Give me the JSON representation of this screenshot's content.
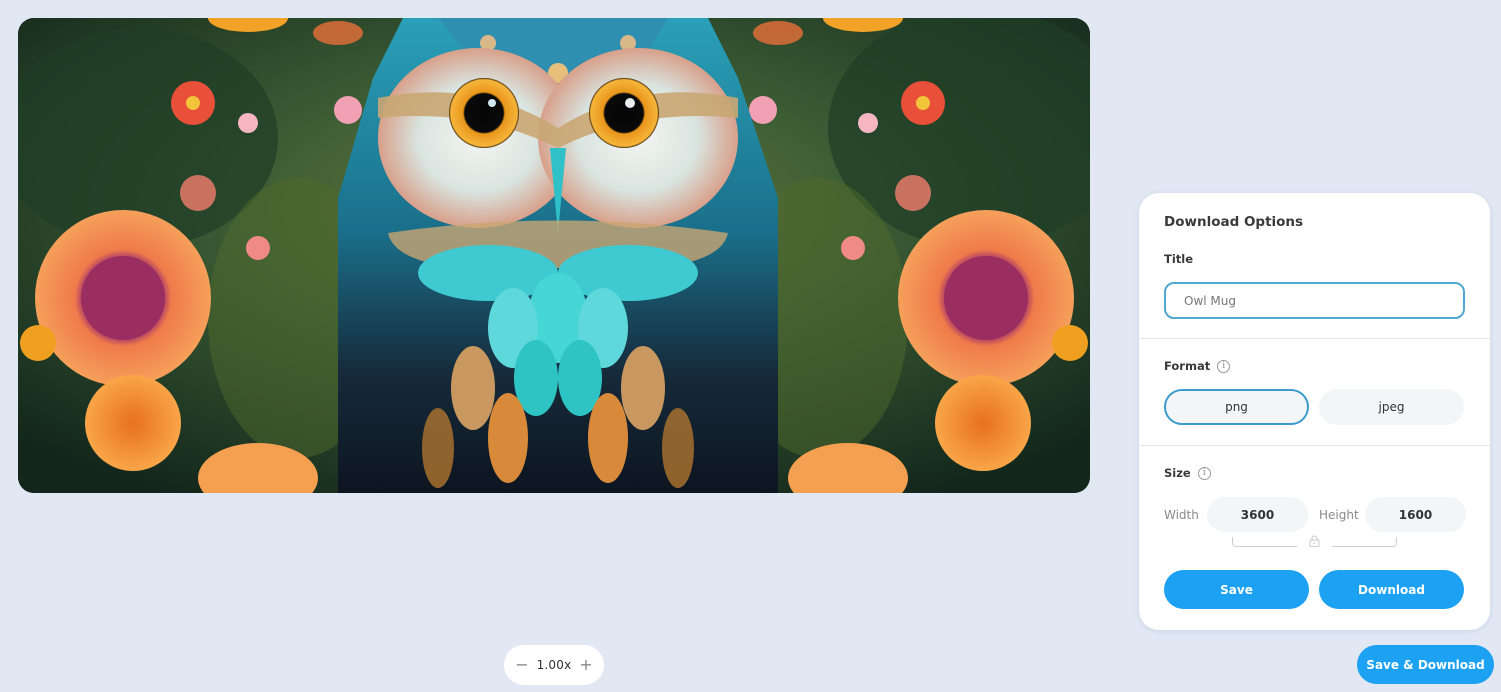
{
  "preview": {
    "image_alt": "Owl among flowers artwork",
    "icon": "owl-artwork-image"
  },
  "zoom": {
    "decrease_icon": "minus-icon",
    "decrease_glyph": "−",
    "value": "1.00x",
    "increase_icon": "plus-icon",
    "increase_glyph": "+"
  },
  "panel": {
    "title": "Download Options",
    "title_field": {
      "label": "Title",
      "value": "Owl Mug",
      "focused": true
    },
    "format": {
      "label": "Format",
      "info_glyph": "i",
      "options": [
        {
          "label": "png",
          "selected": true
        },
        {
          "label": "jpeg",
          "selected": false
        }
      ]
    },
    "size": {
      "label": "Size",
      "info_glyph": "i",
      "width_label": "Width",
      "width_value": "3600",
      "height_label": "Height",
      "height_value": "1600",
      "aspect_lock_icon": "lock-icon"
    },
    "actions": {
      "save_label": "Save",
      "download_label": "Download"
    }
  },
  "save_and_download_label": "Save & Download",
  "colors": {
    "background": "#e1e8f4",
    "accent": "#1da1f2",
    "focus_border": "#4ea8cf",
    "panel": "#ffffff"
  }
}
